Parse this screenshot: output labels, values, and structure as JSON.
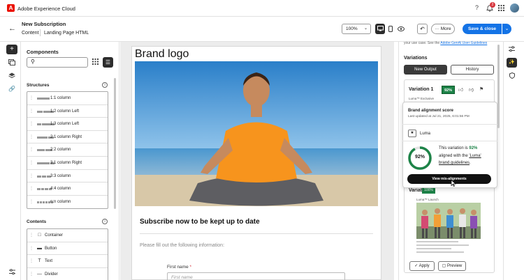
{
  "app": {
    "title": "Adobe Experience Cloud",
    "logo_letter": "A",
    "notifications_count": "2"
  },
  "header": {
    "title": "New Subscription",
    "breadcrumbs": [
      "Content",
      "Landing Page HTML"
    ],
    "zoom": "100%",
    "more_label": "More",
    "save_label": "Save & close"
  },
  "components": {
    "title": "Components",
    "search_placeholder": "",
    "structures_title": "Structures",
    "structures": [
      {
        "label": "1:1 column",
        "bars": [
          12
        ]
      },
      {
        "label": "1:2 column Left",
        "bars": [
          5,
          10
        ]
      },
      {
        "label": "1:3 column Left",
        "bars": [
          4,
          12
        ]
      },
      {
        "label": "2:1 column Right",
        "bars": [
          10,
          5
        ]
      },
      {
        "label": "2:2 column",
        "bars": [
          7,
          7
        ]
      },
      {
        "label": "3:1 column Right",
        "bars": [
          12,
          4
        ]
      },
      {
        "label": "3:3 column",
        "bars": [
          4,
          4,
          4
        ]
      },
      {
        "label": "4:4 column",
        "bars": [
          3,
          3,
          3,
          3
        ]
      },
      {
        "label": "n:n column",
        "bars": [
          2,
          2,
          2,
          2,
          2,
          2
        ]
      }
    ],
    "contents_title": "Contents",
    "contents": [
      {
        "label": "Container",
        "icon": "container-icon"
      },
      {
        "label": "Button",
        "icon": "button-icon"
      },
      {
        "label": "Text",
        "icon": "text-icon"
      },
      {
        "label": "Divider",
        "icon": "divider-icon"
      }
    ]
  },
  "email": {
    "brand_logo": "Brand logo",
    "headline": "Subscribe now to be kept up to date",
    "subtext": "Please fill out the following information:",
    "first_name_label": "First name",
    "required_marker": "*",
    "first_name_placeholder": "First name"
  },
  "variations": {
    "top_note": "your use case. See the",
    "top_link": "Adobe GenAI User Guidelines",
    "title": "Variations",
    "tab_new": "New Output",
    "tab_history": "History",
    "items": [
      {
        "name": "Variation 1",
        "score": "92%",
        "subtitle": "Luma™ Exclusive"
      },
      {
        "name": "Variation 2",
        "score": "100%",
        "subtitle": "Luma™ Launch"
      }
    ],
    "apply_label": "Apply",
    "preview_label": "Preview"
  },
  "popover": {
    "title": "Brand alignment score",
    "updated": "Last updated at Jul 21, 2025, 6:01:56 PM",
    "brand": "Luma",
    "score": "92%",
    "score_value": 0.92,
    "text_pre": "This variation is",
    "text_mid": "aligned with the",
    "text_link": "'Luma' brand guidelines",
    "button": "View mis-alignments"
  },
  "colors": {
    "accent": "#1473e6",
    "score_green": "#1d8348",
    "logo_red": "#eb1000"
  }
}
